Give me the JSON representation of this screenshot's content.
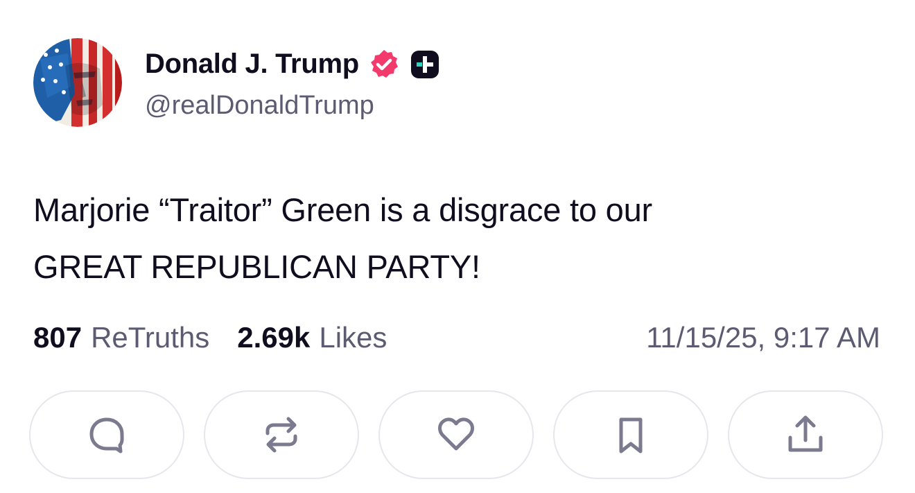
{
  "post": {
    "author": {
      "display_name": "Donald J. Trump",
      "handle": "@realDonaldTrump",
      "verified_color": "#f23a6c",
      "plus_badge_color": "#0f0d1e",
      "plus_accent_color": "#2dd4bf"
    },
    "text_lines": [
      "Marjorie “Traitor” Green is a disgrace to our",
      "GREAT REPUBLICAN PARTY!"
    ],
    "stats": {
      "retruths_count": "807",
      "retruths_label": "ReTruths",
      "likes_count": "2.69k",
      "likes_label": "Likes"
    },
    "timestamp": "11/15/25, 9:17 AM",
    "actions": [
      {
        "name": "reply",
        "icon": "speech-bubble-icon"
      },
      {
        "name": "retruth",
        "icon": "repost-arrows-icon"
      },
      {
        "name": "like",
        "icon": "heart-icon"
      },
      {
        "name": "bookmark",
        "icon": "bookmark-icon"
      },
      {
        "name": "share",
        "icon": "share-upload-icon"
      }
    ]
  },
  "colors": {
    "text_primary": "#0f0d1e",
    "text_secondary": "#5d5b72",
    "icon_gray": "#7b7a8e",
    "button_border": "#e7e6ec"
  }
}
